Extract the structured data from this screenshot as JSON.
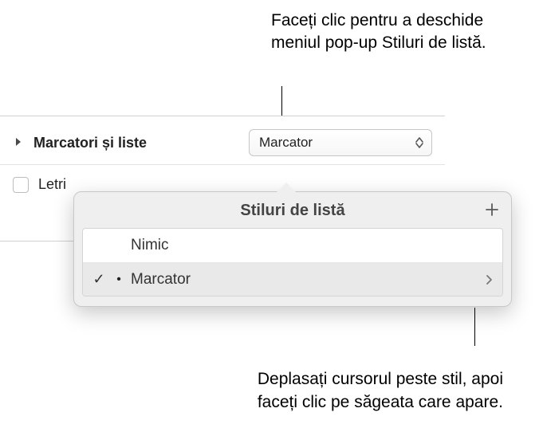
{
  "annotations": {
    "top": "Faceți clic pentru a deschide meniul pop-up Stiluri de listă.",
    "bottom": "Deplasați cursorul peste stil, apoi faceți clic pe săgeata care apare."
  },
  "section": {
    "title": "Marcatori și liste",
    "popup_value": "Marcator",
    "row2_label": "Letri"
  },
  "popover": {
    "title": "Stiluri de listă",
    "items": [
      {
        "label": "Nimic",
        "selected": false,
        "has_arrow": false
      },
      {
        "label": "Marcator",
        "selected": true,
        "has_arrow": true
      }
    ]
  }
}
